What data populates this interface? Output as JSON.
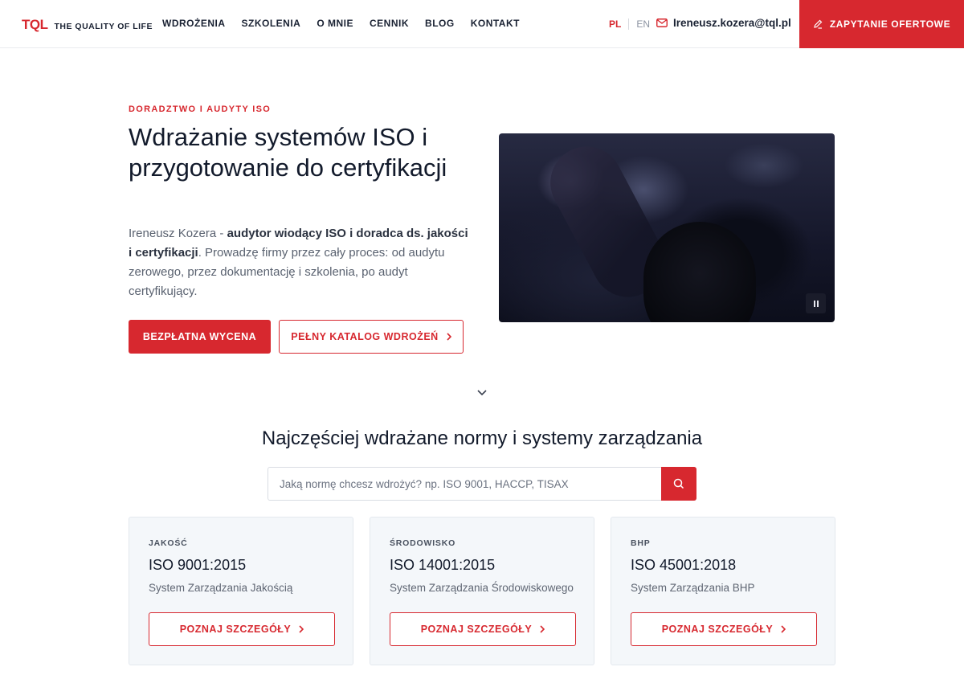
{
  "brand": {
    "mark": "TQL",
    "tagline": "THE QUALITY OF LIFE",
    "accent": "#d7282f"
  },
  "nav": {
    "items": [
      "WDROŻENIA",
      "SZKOLENIA",
      "O MNIE",
      "CENNIK",
      "BLOG",
      "KONTAKT"
    ]
  },
  "lang": {
    "active": "PL",
    "other": "EN"
  },
  "contact": {
    "email": "Ireneusz.kozera@tql.pl"
  },
  "header_cta": {
    "label": "ZAPYTANIE OFERTOWE",
    "icon": "pencil-icon"
  },
  "hero": {
    "eyebrow": "DORADZTWO I AUDYTY ISO",
    "title": "Wdrażanie systemów ISO i przygotowanie do certyfikacji",
    "desc_name": "Ireneusz Kozera - ",
    "desc_bold": "audytor wiodący ISO i doradca ds. jakości i certyfikacji",
    "desc_rest": ". Prowadzę firmy przez cały proces: od audytu zerowego, przez dokumentację i szkolenia, po audyt certyfikujący.",
    "primary_button": "BEZPŁATNA WYCENA",
    "secondary_button": "PEŁNY KATALOG WDROŻEŃ",
    "video_control": "pause-icon"
  },
  "norms_section": {
    "title": "Najczęściej wdrażane normy i systemy zarządzania",
    "search_placeholder": "Jaką normę chcesz wdrożyć? np. ISO 9001, HACCP, TISAX",
    "cards": [
      {
        "category": "JAKOŚĆ",
        "norm": "ISO 9001:2015",
        "subtitle": "System Zarządzania Jakością",
        "button": "POZNAJ SZCZEGÓŁY"
      },
      {
        "category": "ŚRODOWISKO",
        "norm": "ISO 14001:2015",
        "subtitle": "System Zarządzania Środowiskowego",
        "button": "POZNAJ SZCZEGÓŁY"
      },
      {
        "category": "BHP",
        "norm": "ISO 45001:2018",
        "subtitle": "System Zarządzania BHP",
        "button": "POZNAJ SZCZEGÓŁY"
      }
    ]
  }
}
